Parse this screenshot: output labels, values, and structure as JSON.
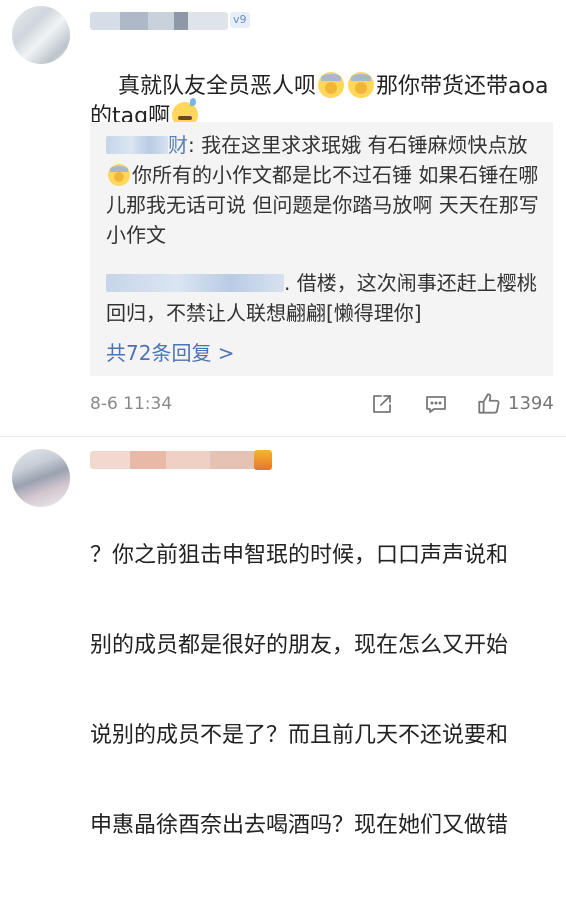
{
  "comments": [
    {
      "text_line1": "真就队友全员恶人呗",
      "text_line1_tail": "那你带货还带aoa",
      "text_line2": "的tag啊",
      "badge_text": "v9",
      "replies": [
        {
          "name_suffix": "财",
          "text": ": 我在这里求求珉娥  有石锤麻烦快点放",
          "text2": "你所有的小作文都是比不过石锤 如果石锤在哪儿那我无话可说 但问题是你踏马放啊 天天在那写小作文"
        },
        {
          "text": ". 借楼，这次闹事还赶上樱桃回归，不禁让人联想翩翩[懒得理你]"
        }
      ],
      "more_replies": "共72条回复 >",
      "timestamp": "8-6 11:34",
      "like_count": "1394",
      "icons": [
        "share-icon",
        "comment-icon",
        "like-icon"
      ]
    },
    {
      "text_lines": [
        "？你之前狙击申智珉的时候，口口声声说和",
        "别的成员都是很好的朋友，现在怎么又开始",
        "说别的成员不是了？而且前几天不还说要和",
        "申惠晶徐酉奈出去喝酒吗？现在她们又做错"
      ]
    }
  ],
  "colors": {
    "link": "#4d73b3",
    "reply_bg": "#f4f4f4",
    "meta": "#8a8a8a"
  }
}
